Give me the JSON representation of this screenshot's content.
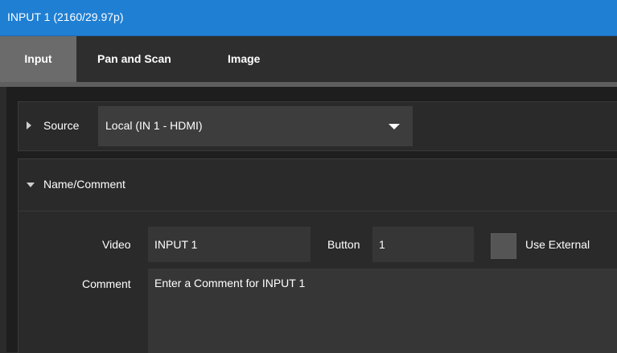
{
  "window": {
    "title": "INPUT 1  (2160/29.97p)"
  },
  "tabs": [
    {
      "label": "Input",
      "active": true
    },
    {
      "label": "Pan and Scan",
      "active": false
    },
    {
      "label": "Image",
      "active": false
    }
  ],
  "source": {
    "label": "Source",
    "value": "Local (IN 1 - HDMI)"
  },
  "name_comment": {
    "header": "Name/Comment",
    "video_label": "Video",
    "video_value": "INPUT 1",
    "button_label": "Button",
    "button_value": "1",
    "use_external_label": "Use External",
    "use_external_checked": false,
    "comment_label": "Comment",
    "comment_value": "Enter a Comment for INPUT 1"
  },
  "colors": {
    "title_bar": "#1f7fd3",
    "active_tab": "#6b6b6b",
    "panel_bg": "#2a2a2a",
    "field_bg": "#363636"
  }
}
